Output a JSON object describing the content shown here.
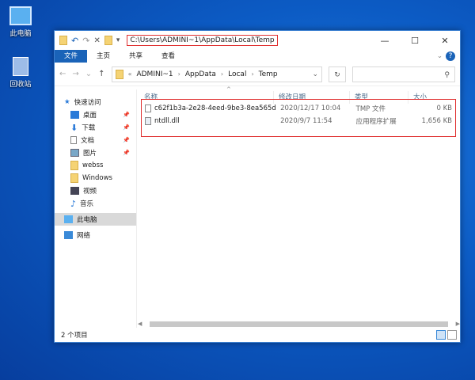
{
  "desktop": [
    {
      "label": "此电脑",
      "icon": "computer-icon"
    },
    {
      "label": "回收站",
      "icon": "recycle-bin-icon"
    }
  ],
  "window": {
    "title_path": "C:\\Users\\ADMINI~1\\AppData\\Local\\Temp",
    "controls": {
      "minimize": "—",
      "maximize": "☐",
      "close": "✕"
    }
  },
  "ribbon": {
    "tabs": [
      "文件",
      "主页",
      "共享",
      "查看"
    ],
    "help": "?"
  },
  "address": {
    "prefix": "«",
    "crumbs": [
      "ADMINI~1",
      "AppData",
      "Local",
      "Temp"
    ]
  },
  "sidebar": {
    "quick_access": "快速访问",
    "items": [
      {
        "label": "桌面",
        "pinned": true
      },
      {
        "label": "下载",
        "pinned": true
      },
      {
        "label": "文档",
        "pinned": true
      },
      {
        "label": "图片",
        "pinned": true
      },
      {
        "label": "webss",
        "pinned": false
      },
      {
        "label": "Windows",
        "pinned": false
      },
      {
        "label": "视频",
        "pinned": false
      },
      {
        "label": "音乐",
        "pinned": false
      }
    ],
    "this_pc": "此电脑",
    "network": "网络"
  },
  "columns": [
    "名称",
    "修改日期",
    "类型",
    "大小"
  ],
  "files": [
    {
      "name": "c62f1b3a-2e28-4eed-9be3-8ea565d0...",
      "date": "2020/12/17 10:04",
      "type": "TMP 文件",
      "size": "0 KB"
    },
    {
      "name": "ntdll.dll",
      "date": "2020/9/7 11:54",
      "type": "应用程序扩展",
      "size": "1,656 KB"
    }
  ],
  "status": {
    "count": "2 个项目"
  },
  "colors": {
    "accent": "#1a63b8",
    "highlight": "#e03030"
  }
}
